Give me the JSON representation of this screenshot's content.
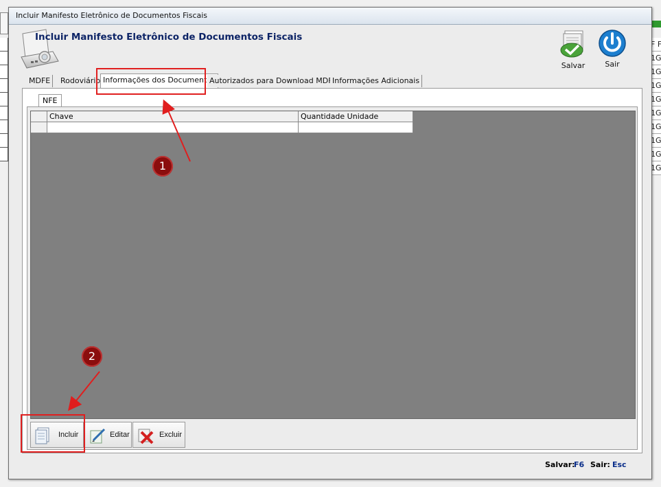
{
  "background": {
    "right_column_items": [
      "F F",
      "1G",
      "1G",
      "1G",
      "1G",
      "1G",
      "1G",
      "1G",
      "1G",
      "1G"
    ]
  },
  "window": {
    "title": "Incluir Manifesto Eletrônico de Documentos Fiscais",
    "header_title": "Incluir Manifesto Eletrônico de Documentos Fiscais"
  },
  "toolbar": {
    "save_label": "Salvar",
    "exit_label": "Sair"
  },
  "tabs": [
    {
      "label": "MDFE"
    },
    {
      "label": "Rodoviário"
    },
    {
      "label": "Informações dos Documentos"
    },
    {
      "label": "Autorizados para Download MDF-e"
    },
    {
      "label": "Informações Adicionais"
    }
  ],
  "inner_tab": {
    "label": "NFE"
  },
  "grid": {
    "columns": [
      "",
      "Chave",
      "Quantidade Unidade"
    ],
    "rows": [
      [
        "",
        "",
        ""
      ]
    ]
  },
  "actions": {
    "include_label": "Incluir",
    "edit_label": "Editar",
    "delete_label": "Excluir"
  },
  "status": {
    "save_text": "Salvar:",
    "save_key": "F6",
    "exit_text": "Sair:",
    "exit_key": "Esc"
  },
  "annotations": {
    "badge1": "1",
    "badge2": "2",
    "color": "#e01e1e",
    "badge_color": "#8b0d0d"
  }
}
